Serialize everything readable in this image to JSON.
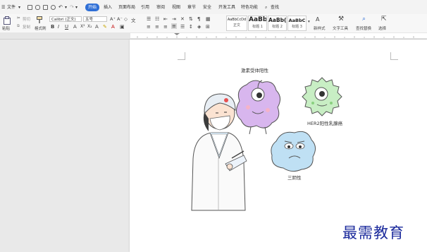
{
  "menu": {
    "file": "文件",
    "tabs": [
      "开始",
      "插入",
      "页面布局",
      "引用",
      "审阅",
      "视图",
      "章节",
      "安全",
      "开发工具",
      "特色功能"
    ],
    "active_tab": "开始",
    "search": "查找"
  },
  "ribbon": {
    "paste": "粘贴",
    "cut": "剪切",
    "copy": "复制",
    "format_painter": "格式刷",
    "font_name": "Calibri (正文)",
    "font_size": "五号",
    "styles": [
      {
        "sample": "AaBbCcDd",
        "name": "正文"
      },
      {
        "sample": "AaBb",
        "name": "标题 1"
      },
      {
        "sample": "AaBb(",
        "name": "标题 2"
      },
      {
        "sample": "AaBbC",
        "name": "标题 3"
      }
    ],
    "new_style": "新样式",
    "text_tools": "文字工具",
    "find_replace": "查找替换",
    "select": "选择"
  },
  "document": {
    "labels": {
      "hormone": "激素受体阳性",
      "her2": "HER2阳性乳腺癌",
      "triple_negative": "三阴性"
    }
  },
  "watermark": "最需教育",
  "colors": {
    "accent": "#2f6fd6",
    "watermark": "#1b2a9c",
    "purple_cell": "#d8b6ee",
    "green_cell": "#c8eec4",
    "blue_cell": "#bfe0f4"
  }
}
